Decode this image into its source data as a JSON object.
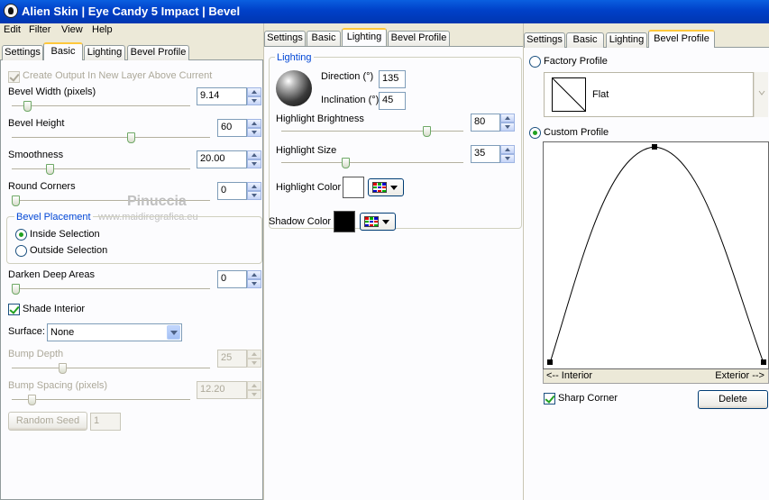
{
  "window": {
    "title": "Alien Skin  |  Eye Candy 5 Impact  |  Bevel"
  },
  "menu": [
    "Edit",
    "Filter",
    "View",
    "Help"
  ],
  "panel1": {
    "tabs": [
      "Settings",
      "Basic",
      "Lighting",
      "Bevel Profile"
    ],
    "active_tab": "Basic",
    "create_output": "Create Output In New Layer Above Current",
    "bevel_width": {
      "label": "Bevel Width (pixels)",
      "value": "9.14"
    },
    "bevel_height": {
      "label": "Bevel Height",
      "value": "60"
    },
    "smoothness": {
      "label": "Smoothness",
      "value": "20.00"
    },
    "round_corners": {
      "label": "Round Corners",
      "value": "0"
    },
    "bevel_placement": {
      "title": "Bevel Placement",
      "inside": "Inside Selection",
      "outside": "Outside Selection",
      "selected": "inside"
    },
    "darken_deep_areas": {
      "label": "Darken Deep Areas",
      "value": "0"
    },
    "shade_interior": "Shade Interior",
    "surface": {
      "label": "Surface:",
      "value": "None"
    },
    "bump_depth": {
      "label": "Bump Depth",
      "value": "25"
    },
    "bump_spacing": {
      "label": "Bump Spacing (pixels)",
      "value": "12.20"
    },
    "random_seed": {
      "label": "Random Seed",
      "value": "1"
    },
    "watermark": {
      "name": "Pinuccia",
      "url": "www.maidiregrafica.eu"
    }
  },
  "panel2": {
    "tabs": [
      "Settings",
      "Basic",
      "Lighting",
      "Bevel Profile"
    ],
    "active_tab": "Lighting",
    "group_title": "Lighting",
    "direction": {
      "label": "Direction (°)",
      "value": "135"
    },
    "inclination": {
      "label": "Inclination (°)",
      "value": "45"
    },
    "highlight_brightness": {
      "label": "Highlight Brightness",
      "value": "80"
    },
    "highlight_size": {
      "label": "Highlight Size",
      "value": "35"
    },
    "highlight_color": {
      "label": "Highlight Color",
      "color": "#ffffff"
    },
    "shadow_color": {
      "label": "Shadow Color",
      "color": "#000000"
    }
  },
  "panel3": {
    "tabs": [
      "Settings",
      "Basic",
      "Lighting",
      "Bevel Profile"
    ],
    "active_tab": "Bevel Profile",
    "factory_profile": "Factory Profile",
    "factory_item": "Flat",
    "custom_profile": "Custom Profile",
    "axis_left": "<-- Interior",
    "axis_right": "Exterior -->",
    "sharp_corner": "Sharp Corner",
    "delete": "Delete"
  }
}
